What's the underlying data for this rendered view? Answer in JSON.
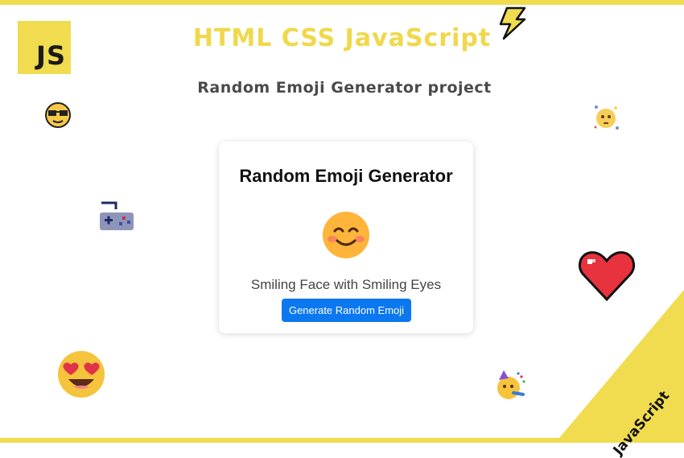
{
  "header": {
    "logo_text": "JS",
    "title": "HTML CSS JavaScript",
    "subtitle": "Random Emoji Generator project"
  },
  "card": {
    "title": "Random Emoji Generator",
    "emoji_name": "Smiling Face with Smiling Eyes",
    "button_label": "Generate Random Emoji"
  },
  "corner": {
    "label": "JavaScript"
  },
  "decorations": {
    "icons": [
      "lightning-icon",
      "sunglasses-face-icon",
      "dizzy-face-icon",
      "gamepad-icon",
      "heart-icon",
      "heart-eyes-face-icon",
      "party-face-icon",
      "smiling-face-icon"
    ]
  },
  "colors": {
    "accent_yellow": "#f0dc4e",
    "button_blue": "#0b78f0"
  }
}
